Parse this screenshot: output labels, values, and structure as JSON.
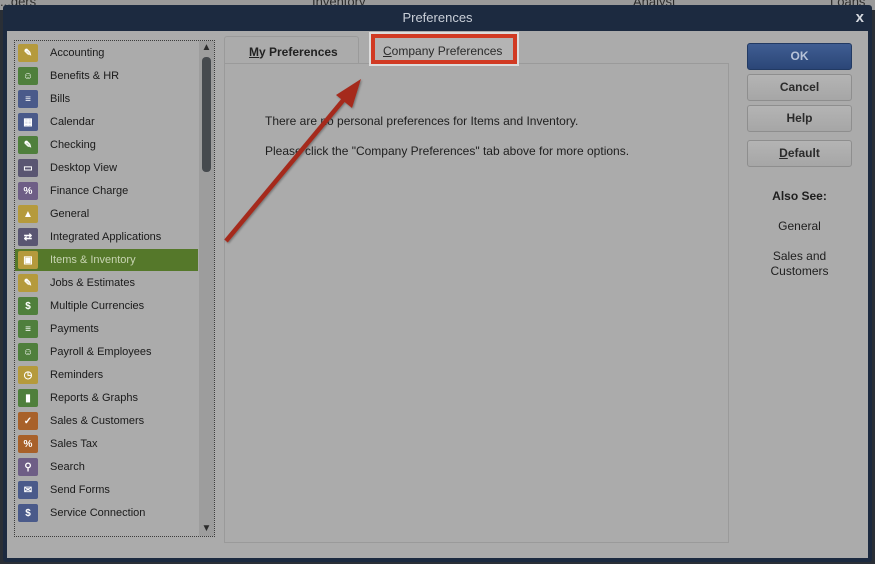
{
  "background": {
    "texts": [
      "...ders",
      "Inventory",
      "Analyst",
      "Loans"
    ]
  },
  "window": {
    "title": "Preferences",
    "close_label": "x"
  },
  "sidebar": {
    "items": [
      {
        "label": "Accounting",
        "icon": "accounting-icon",
        "color": "#b59a3c",
        "glyph": "✎"
      },
      {
        "label": "Benefits & HR",
        "icon": "benefits-hr-icon",
        "color": "#4f7f3c",
        "glyph": "☺"
      },
      {
        "label": "Bills",
        "icon": "bills-icon",
        "color": "#4a5a8a",
        "glyph": "≡"
      },
      {
        "label": "Calendar",
        "icon": "calendar-icon",
        "color": "#4a5a8a",
        "glyph": "▦"
      },
      {
        "label": "Checking",
        "icon": "checking-icon",
        "color": "#4f7f3c",
        "glyph": "✎"
      },
      {
        "label": "Desktop View",
        "icon": "desktop-view-icon",
        "color": "#5a5672",
        "glyph": "▭"
      },
      {
        "label": "Finance Charge",
        "icon": "finance-charge-icon",
        "color": "#6e5e86",
        "glyph": "%"
      },
      {
        "label": "General",
        "icon": "general-icon",
        "color": "#b59a3c",
        "glyph": "▲"
      },
      {
        "label": "Integrated Applications",
        "icon": "integrated-applications-icon",
        "color": "#5a5672",
        "glyph": "⇄"
      },
      {
        "label": "Items & Inventory",
        "icon": "items-inventory-icon",
        "color": "#b59a3c",
        "glyph": "▣",
        "selected": true
      },
      {
        "label": "Jobs & Estimates",
        "icon": "jobs-estimates-icon",
        "color": "#b59a3c",
        "glyph": "✎"
      },
      {
        "label": "Multiple Currencies",
        "icon": "multiple-currencies-icon",
        "color": "#4f7f3c",
        "glyph": "$"
      },
      {
        "label": "Payments",
        "icon": "payments-icon",
        "color": "#4f7f3c",
        "glyph": "≡"
      },
      {
        "label": "Payroll & Employees",
        "icon": "payroll-employees-icon",
        "color": "#4f7f3c",
        "glyph": "☺"
      },
      {
        "label": "Reminders",
        "icon": "reminders-icon",
        "color": "#b59a3c",
        "glyph": "◷"
      },
      {
        "label": "Reports & Graphs",
        "icon": "reports-graphs-icon",
        "color": "#4f7f3c",
        "glyph": "▮"
      },
      {
        "label": "Sales & Customers",
        "icon": "sales-customers-icon",
        "color": "#a8612a",
        "glyph": "✓"
      },
      {
        "label": "Sales Tax",
        "icon": "sales-tax-icon",
        "color": "#a8612a",
        "glyph": "%"
      },
      {
        "label": "Search",
        "icon": "search-icon",
        "color": "#6e5e86",
        "glyph": "⚲"
      },
      {
        "label": "Send Forms",
        "icon": "send-forms-icon",
        "color": "#4a5a8a",
        "glyph": "✉"
      },
      {
        "label": "Service Connection",
        "icon": "service-connection-icon",
        "color": "#4a5a8a",
        "glyph": "$"
      }
    ]
  },
  "tabs": {
    "my_preferences": {
      "mnemonic": "M",
      "rest": "y Preferences"
    },
    "company_preferences": {
      "mnemonic": "C",
      "rest": "ompany Preferences"
    }
  },
  "panel": {
    "message1": "There are no personal preferences for Items and Inventory.",
    "message2": "Please click the \"Company Preferences\" tab above for more options."
  },
  "buttons": {
    "ok": "OK",
    "cancel": "Cancel",
    "help": "Help",
    "default_mnemonic": "D",
    "default_rest": "efault"
  },
  "also_see": {
    "title": "Also See:",
    "links": [
      "General",
      "Sales and Customers"
    ]
  },
  "annotation": {
    "highlight_color": "#d13a23",
    "arrow_color": "#a52a1c"
  }
}
